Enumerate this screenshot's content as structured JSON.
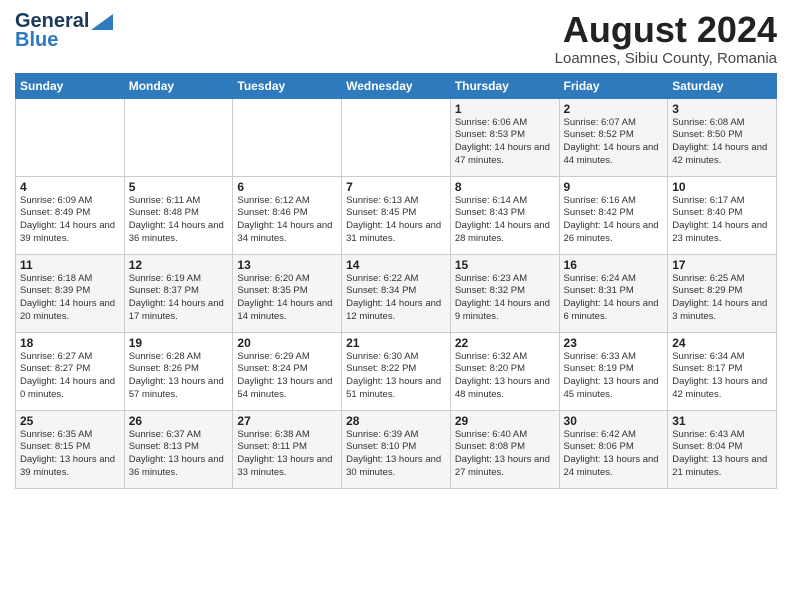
{
  "header": {
    "logo_line1": "General",
    "logo_line2": "Blue",
    "month_year": "August 2024",
    "location": "Loamnes, Sibiu County, Romania"
  },
  "days_of_week": [
    "Sunday",
    "Monday",
    "Tuesday",
    "Wednesday",
    "Thursday",
    "Friday",
    "Saturday"
  ],
  "weeks": [
    [
      {
        "day": "",
        "detail": ""
      },
      {
        "day": "",
        "detail": ""
      },
      {
        "day": "",
        "detail": ""
      },
      {
        "day": "",
        "detail": ""
      },
      {
        "day": "1",
        "detail": "Sunrise: 6:06 AM\nSunset: 8:53 PM\nDaylight: 14 hours and 47 minutes."
      },
      {
        "day": "2",
        "detail": "Sunrise: 6:07 AM\nSunset: 8:52 PM\nDaylight: 14 hours and 44 minutes."
      },
      {
        "day": "3",
        "detail": "Sunrise: 6:08 AM\nSunset: 8:50 PM\nDaylight: 14 hours and 42 minutes."
      }
    ],
    [
      {
        "day": "4",
        "detail": "Sunrise: 6:09 AM\nSunset: 8:49 PM\nDaylight: 14 hours and 39 minutes."
      },
      {
        "day": "5",
        "detail": "Sunrise: 6:11 AM\nSunset: 8:48 PM\nDaylight: 14 hours and 36 minutes."
      },
      {
        "day": "6",
        "detail": "Sunrise: 6:12 AM\nSunset: 8:46 PM\nDaylight: 14 hours and 34 minutes."
      },
      {
        "day": "7",
        "detail": "Sunrise: 6:13 AM\nSunset: 8:45 PM\nDaylight: 14 hours and 31 minutes."
      },
      {
        "day": "8",
        "detail": "Sunrise: 6:14 AM\nSunset: 8:43 PM\nDaylight: 14 hours and 28 minutes."
      },
      {
        "day": "9",
        "detail": "Sunrise: 6:16 AM\nSunset: 8:42 PM\nDaylight: 14 hours and 26 minutes."
      },
      {
        "day": "10",
        "detail": "Sunrise: 6:17 AM\nSunset: 8:40 PM\nDaylight: 14 hours and 23 minutes."
      }
    ],
    [
      {
        "day": "11",
        "detail": "Sunrise: 6:18 AM\nSunset: 8:39 PM\nDaylight: 14 hours and 20 minutes."
      },
      {
        "day": "12",
        "detail": "Sunrise: 6:19 AM\nSunset: 8:37 PM\nDaylight: 14 hours and 17 minutes."
      },
      {
        "day": "13",
        "detail": "Sunrise: 6:20 AM\nSunset: 8:35 PM\nDaylight: 14 hours and 14 minutes."
      },
      {
        "day": "14",
        "detail": "Sunrise: 6:22 AM\nSunset: 8:34 PM\nDaylight: 14 hours and 12 minutes."
      },
      {
        "day": "15",
        "detail": "Sunrise: 6:23 AM\nSunset: 8:32 PM\nDaylight: 14 hours and 9 minutes."
      },
      {
        "day": "16",
        "detail": "Sunrise: 6:24 AM\nSunset: 8:31 PM\nDaylight: 14 hours and 6 minutes."
      },
      {
        "day": "17",
        "detail": "Sunrise: 6:25 AM\nSunset: 8:29 PM\nDaylight: 14 hours and 3 minutes."
      }
    ],
    [
      {
        "day": "18",
        "detail": "Sunrise: 6:27 AM\nSunset: 8:27 PM\nDaylight: 14 hours and 0 minutes."
      },
      {
        "day": "19",
        "detail": "Sunrise: 6:28 AM\nSunset: 8:26 PM\nDaylight: 13 hours and 57 minutes."
      },
      {
        "day": "20",
        "detail": "Sunrise: 6:29 AM\nSunset: 8:24 PM\nDaylight: 13 hours and 54 minutes."
      },
      {
        "day": "21",
        "detail": "Sunrise: 6:30 AM\nSunset: 8:22 PM\nDaylight: 13 hours and 51 minutes."
      },
      {
        "day": "22",
        "detail": "Sunrise: 6:32 AM\nSunset: 8:20 PM\nDaylight: 13 hours and 48 minutes."
      },
      {
        "day": "23",
        "detail": "Sunrise: 6:33 AM\nSunset: 8:19 PM\nDaylight: 13 hours and 45 minutes."
      },
      {
        "day": "24",
        "detail": "Sunrise: 6:34 AM\nSunset: 8:17 PM\nDaylight: 13 hours and 42 minutes."
      }
    ],
    [
      {
        "day": "25",
        "detail": "Sunrise: 6:35 AM\nSunset: 8:15 PM\nDaylight: 13 hours and 39 minutes."
      },
      {
        "day": "26",
        "detail": "Sunrise: 6:37 AM\nSunset: 8:13 PM\nDaylight: 13 hours and 36 minutes."
      },
      {
        "day": "27",
        "detail": "Sunrise: 6:38 AM\nSunset: 8:11 PM\nDaylight: 13 hours and 33 minutes."
      },
      {
        "day": "28",
        "detail": "Sunrise: 6:39 AM\nSunset: 8:10 PM\nDaylight: 13 hours and 30 minutes."
      },
      {
        "day": "29",
        "detail": "Sunrise: 6:40 AM\nSunset: 8:08 PM\nDaylight: 13 hours and 27 minutes."
      },
      {
        "day": "30",
        "detail": "Sunrise: 6:42 AM\nSunset: 8:06 PM\nDaylight: 13 hours and 24 minutes."
      },
      {
        "day": "31",
        "detail": "Sunrise: 6:43 AM\nSunset: 8:04 PM\nDaylight: 13 hours and 21 minutes."
      }
    ]
  ]
}
